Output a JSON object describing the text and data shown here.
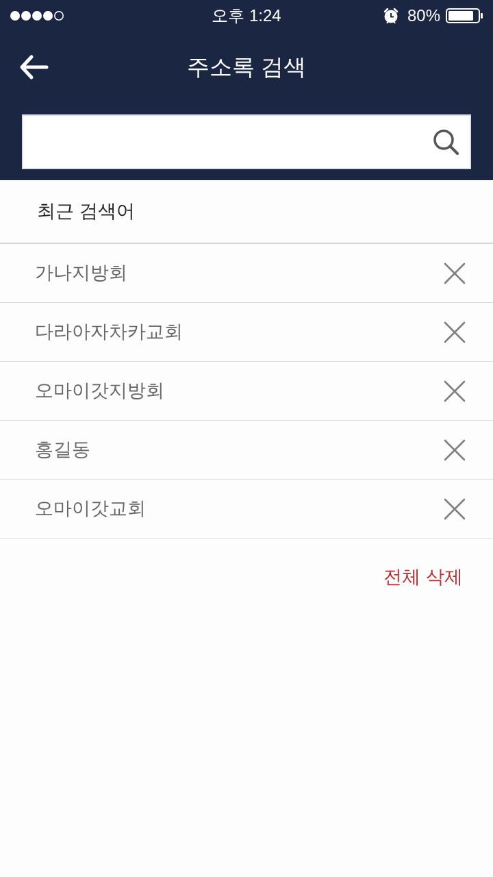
{
  "status_bar": {
    "time": "오후 1:24",
    "battery": "80%"
  },
  "header": {
    "title": "주소록 검색"
  },
  "recent": {
    "heading": "최근 검색어",
    "items": [
      {
        "label": "가나지방회"
      },
      {
        "label": "다라아자차카교회"
      },
      {
        "label": "오마이갓지방회"
      },
      {
        "label": "홍길동"
      },
      {
        "label": "오마이갓교회"
      }
    ],
    "clear_all": "전체 삭제"
  }
}
